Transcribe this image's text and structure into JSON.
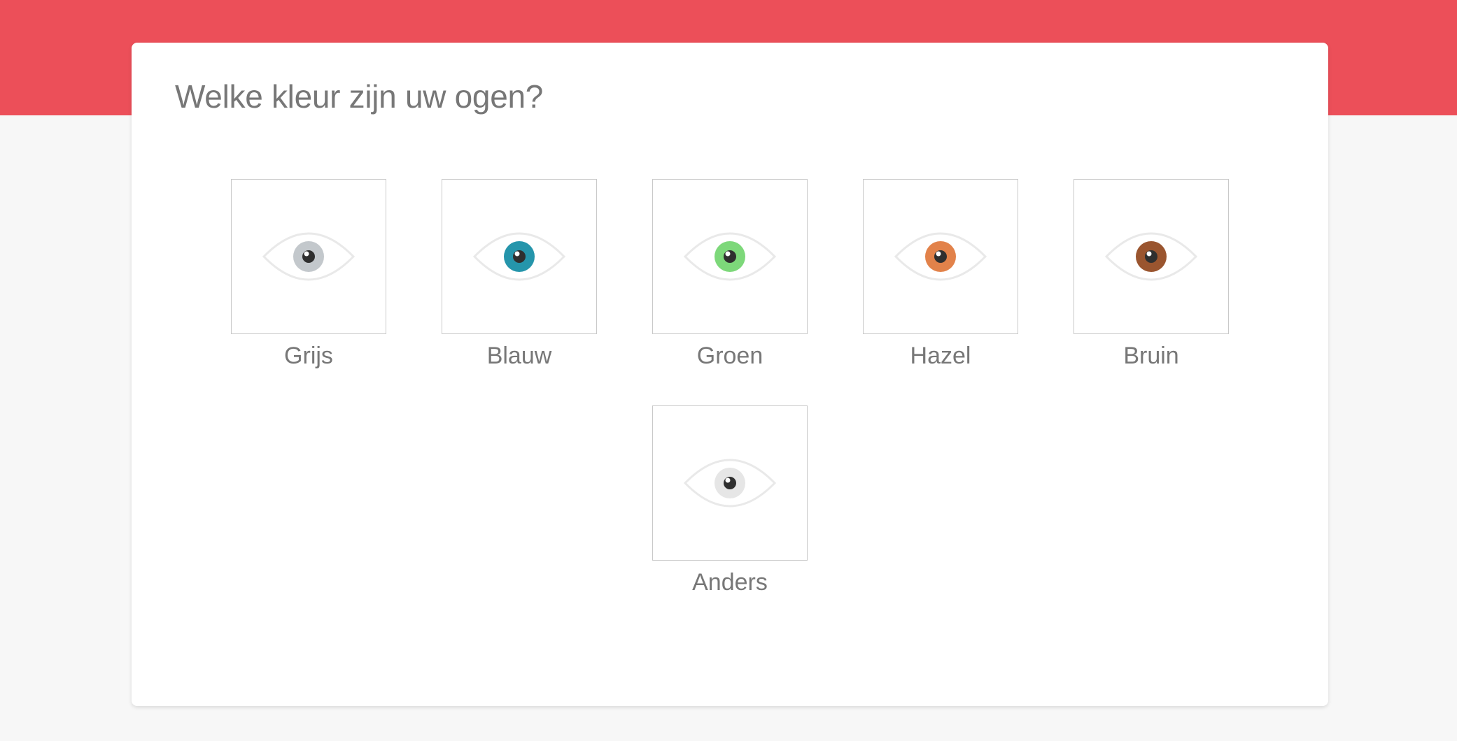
{
  "question": {
    "title": "Welke kleur zijn uw ogen?"
  },
  "options": [
    {
      "label": "Grijs",
      "icon": "eye-icon",
      "iris_color": "#c3c8cc"
    },
    {
      "label": "Blauw",
      "icon": "eye-icon",
      "iris_color": "#2595ab"
    },
    {
      "label": "Groen",
      "icon": "eye-icon",
      "iris_color": "#7dd87a"
    },
    {
      "label": "Hazel",
      "icon": "eye-icon",
      "iris_color": "#e2824a"
    },
    {
      "label": "Bruin",
      "icon": "eye-icon",
      "iris_color": "#9a552f"
    },
    {
      "label": "Anders",
      "icon": "eye-icon",
      "iris_color": "#e6e6e6"
    }
  ],
  "colors": {
    "header_band": "#ec4f59",
    "page_background": "#f7f7f7",
    "card_background": "#ffffff",
    "text": "#777777",
    "eye_outline": "#e9e9e9",
    "pupil": "#2f2f2f"
  }
}
